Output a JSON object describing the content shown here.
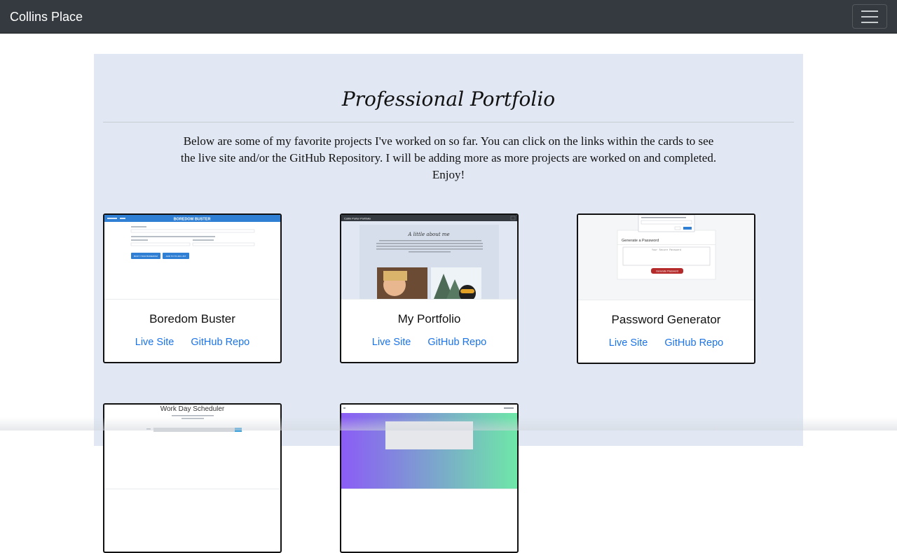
{
  "navbar": {
    "brand": "Collins Place",
    "toggler_icon": "hamburger-icon"
  },
  "main": {
    "title": "Professional Portfolio",
    "intro": "Below are some of my favorite projects I've worked on so far. You can click on the links within the cards to see the live site and/or the GitHub Repository. I will be adding more as more projects are worked on and completed. Enjoy!"
  },
  "cards": [
    {
      "title": "Boredom Buster",
      "live_label": "Live Site",
      "repo_label": "GitHub Repo",
      "thumb": {
        "brand": "BOREDOM BUSTER",
        "button_1": "BUST YOUR BOREDOM",
        "button_2": "ADD TO TO-DO LIST"
      }
    },
    {
      "title": "My Portfolio",
      "live_label": "Live Site",
      "repo_label": "GitHub Repo",
      "thumb": {
        "nav": "Collin Porter Portfolio",
        "heading": "A little about me"
      }
    },
    {
      "title": "Password Generator",
      "live_label": "Live Site",
      "repo_label": "GitHub Repo",
      "thumb": {
        "heading": "Generate a Password",
        "field_placeholder": "Your Secure Password",
        "button": "Generate Password"
      }
    },
    {
      "title": "Work Day Scheduler",
      "live_label": "",
      "repo_label": ""
    },
    {
      "title": "",
      "live_label": "",
      "repo_label": ""
    }
  ],
  "colors": {
    "navbar_bg": "#343a40",
    "panel_bg": "#e1e8f3",
    "link": "#1a73e8",
    "boredom_blue": "#2f7fd4",
    "password_red": "#b52b2b"
  }
}
